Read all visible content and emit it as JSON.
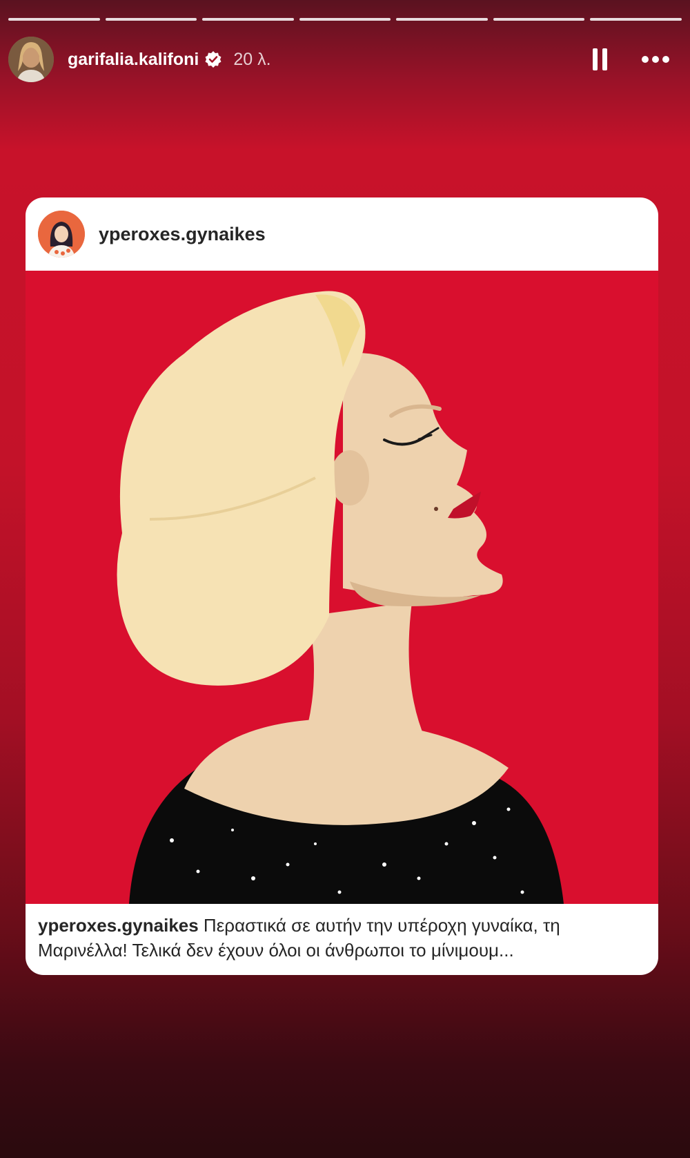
{
  "story": {
    "segments": 7,
    "username": "garifalia.kalifoni",
    "time": "20 λ."
  },
  "post": {
    "username": "yperoxes.gynaikes",
    "caption_username": "yperoxes.gynaikes",
    "caption_text": " Περαστικά σε αυτήν την υπέροχη γυναίκα, τη Μαρινέλλα! Τελικά δεν έχουν όλοι οι άνθρωποι το μίνιμουμ..."
  },
  "icons": {
    "verified": "verified-badge-icon",
    "pause": "pause-icon",
    "more": "more-options-icon"
  },
  "colors": {
    "illustration_bg": "#d90f2e",
    "hair": "#f6e2b4",
    "skin": "#eed2ae",
    "lips": "#c0102a",
    "dress": "#0b0b0b"
  }
}
